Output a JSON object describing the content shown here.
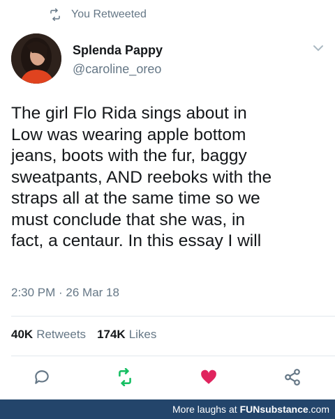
{
  "retweet_context": {
    "label": "You Retweeted",
    "icon": "retweet-icon"
  },
  "author": {
    "name": "Splenda Pappy",
    "handle": "@caroline_oreo",
    "avatar_icon": "profile-photo"
  },
  "tweet": {
    "text": "The girl Flo Rida sings about in\nLow was wearing apple bottom\njeans, boots with the fur, baggy\nsweatpants, AND reeboks with the\nstraps all at the same time so we\nmust conclude that she was, in\nfact, a centaur. In this essay I will",
    "timestamp": "2:30 PM · 26 Mar 18"
  },
  "stats": {
    "retweets_count": "40K",
    "retweets_label": "Retweets",
    "likes_count": "174K",
    "likes_label": "Likes"
  },
  "actions": {
    "reply_icon": "reply-icon",
    "retweet_icon": "retweet-icon",
    "like_icon": "heart-icon",
    "share_icon": "share-icon"
  },
  "colors": {
    "retweet_green": "#17bf63",
    "like_red": "#e0245e",
    "muted": "#657786",
    "footer_bg": "#23456b"
  },
  "footer": {
    "prefix": "More laughs at",
    "brand_main": "FUNsubstance",
    "brand_suffix": ".com"
  }
}
